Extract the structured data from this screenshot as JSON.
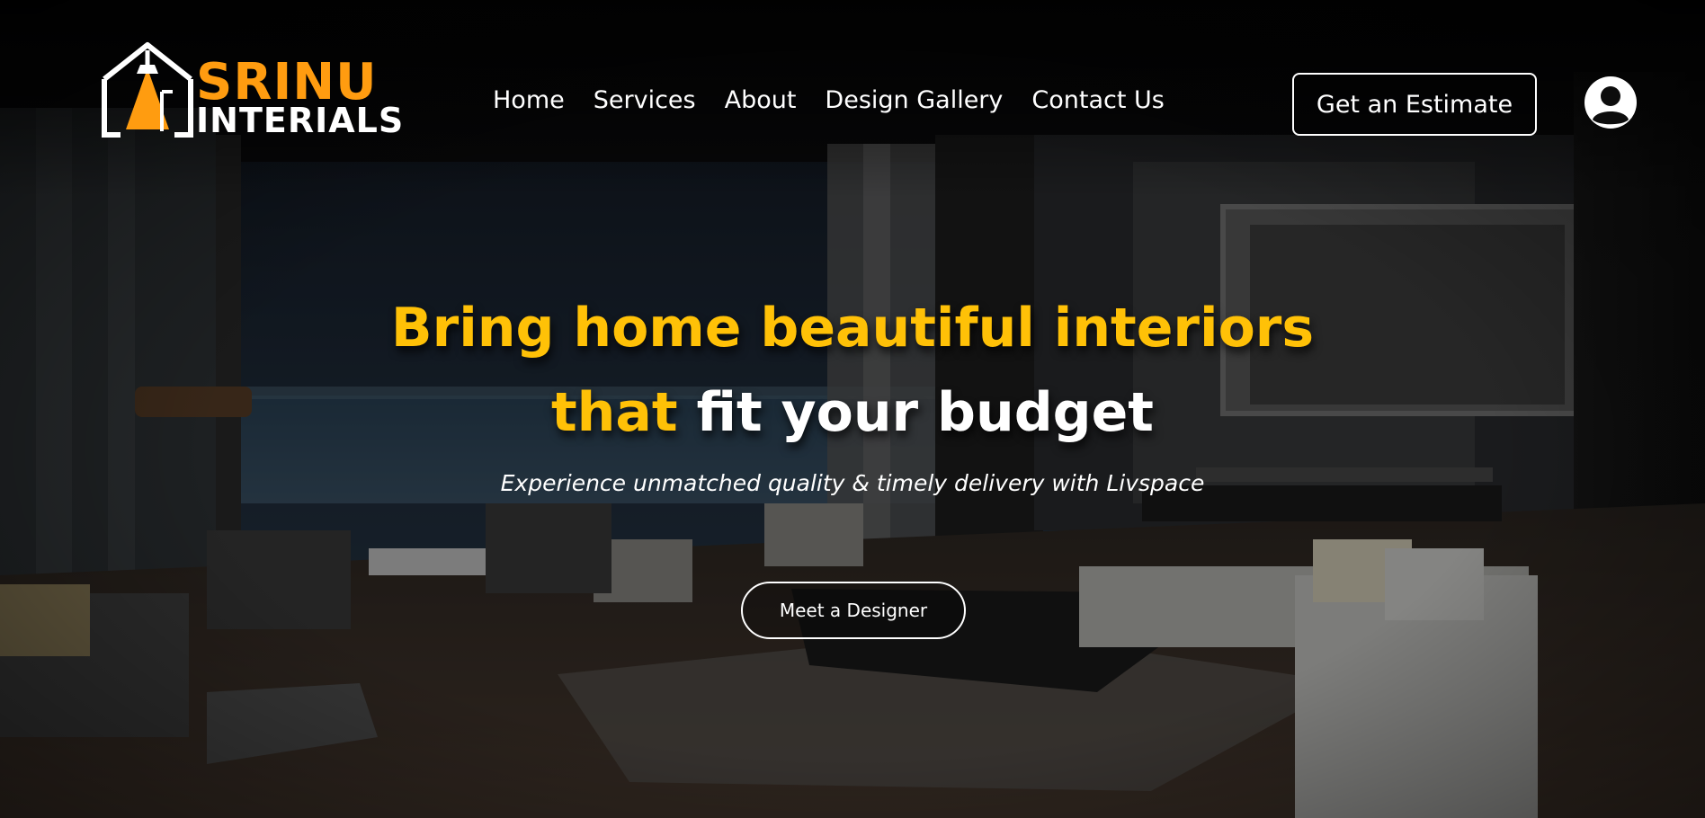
{
  "brand": {
    "name_line1": "SRINU",
    "name_line2": "INTERIALS",
    "accent_color": "#ff9c10"
  },
  "nav": {
    "items": [
      {
        "label": "Home"
      },
      {
        "label": "Services"
      },
      {
        "label": "About"
      },
      {
        "label": "Design Gallery"
      },
      {
        "label": "Contact Us"
      }
    ]
  },
  "header": {
    "estimate_label": "Get an Estimate",
    "account_icon": "user-circle-icon"
  },
  "hero": {
    "headline_line1": "Bring home beautiful interiors",
    "headline_line2_accent": "that",
    "headline_line2_rest": "fit your budget",
    "subheadline": "Experience unmatched quality & timely delivery with Livspace",
    "cta_label": "Meet a Designer",
    "headline_accent_color": "#ffc107",
    "headline_color": "#ffffff"
  }
}
